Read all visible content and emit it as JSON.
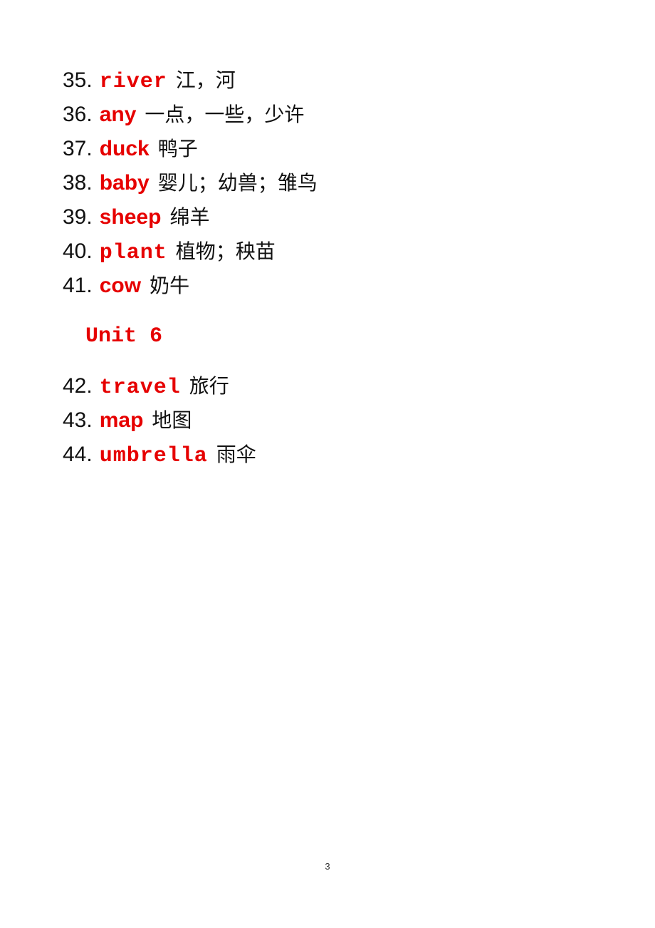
{
  "entries": [
    {
      "num": "35.",
      "word": "river",
      "meaning": "江，河",
      "mono": true
    },
    {
      "num": "36.",
      "word": "any",
      "meaning": "一点，一些，少许",
      "mono": false
    },
    {
      "num": "37.",
      "word": "duck",
      "meaning": "鸭子",
      "mono": false
    },
    {
      "num": "38.",
      "word": "baby",
      "meaning": "婴儿；幼兽；雏鸟",
      "mono": false
    },
    {
      "num": "39.",
      "word": "sheep",
      "meaning": "绵羊",
      "mono": false
    },
    {
      "num": "40.",
      "word": "plant",
      "meaning": "植物；秧苗",
      "mono": true
    },
    {
      "num": "41.",
      "word": "cow",
      "meaning": "奶牛",
      "mono": false
    }
  ],
  "unit_heading": "Unit 6",
  "entries_unit6": [
    {
      "num": "42.",
      "word": "travel",
      "meaning": "旅行",
      "mono": true
    },
    {
      "num": "43.",
      "word": "map",
      "meaning": "地图",
      "mono": false
    },
    {
      "num": "44.",
      "word": "umbrella",
      "meaning": "雨伞",
      "mono": true
    }
  ],
  "page_number": "3",
  "colors": {
    "word": "#e60000",
    "text": "#111111"
  }
}
